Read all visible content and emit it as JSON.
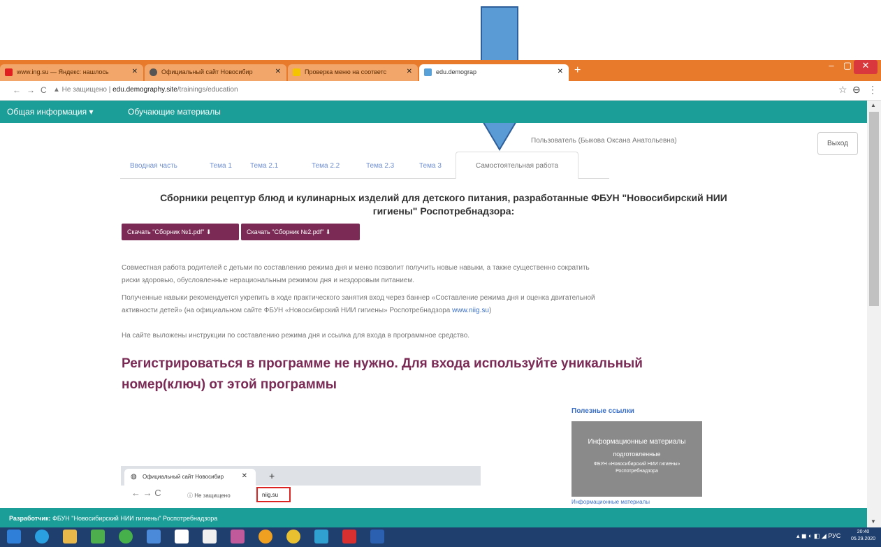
{
  "browser": {
    "tabs": [
      {
        "title": "www.ing.su — Яндекс: нашлось",
        "icon_color": "#e02020"
      },
      {
        "title": "Официальный сайт Новосибир",
        "icon_color": "#555555"
      },
      {
        "title": "Проверка меню на соответс",
        "icon_color": "#f5c400"
      },
      {
        "title": "edu.demograp",
        "icon_color": "#58a0d8",
        "active": true
      }
    ],
    "new_tab": "+",
    "window_controls": {
      "minimize": "–",
      "maximize": "▢",
      "close": "✕"
    },
    "nav": {
      "back": "←",
      "forward": "→",
      "reload": "C"
    },
    "url_secure_label": "▲ Не защищено",
    "url_host": "edu.demography.site",
    "url_path": "/trainings/education",
    "star": "☆",
    "account": "⊖",
    "menu": "⋮"
  },
  "site_nav": {
    "items": [
      "Общая информация ▾",
      "Обучающие материалы"
    ]
  },
  "user": {
    "label": "Пользователь (Быкова Оксана Анатольевна)",
    "logout": "Выход"
  },
  "page_tabs": [
    "Вводная часть",
    "Тема 1",
    "Тема 2.1",
    "Тема 2.2",
    "Тема 2.3",
    "Тема 3",
    "Самостоятельная работа"
  ],
  "active_tab_index": 6,
  "content": {
    "heading_line1": "Сборники рецептур блюд и кулинарных изделий для детского питания, разработанные ФБУН \"Новосибирский НИИ",
    "heading_line2": "гигиены\" Роспотребнадзора:",
    "download_buttons": [
      "Скачать \"Сборник №1.pdf\" ⬇",
      "Скачать \"Сборник №2.pdf\" ⬇"
    ],
    "para1_line1": "Совместная работа родителей с детьми по составлению режима дня и меню позволит получить новые навыки, а также существенно сократить",
    "para1_line2": "риски здоровью, обусловленные нерациональным режимом дня и нездоровым питанием.",
    "para2_line1": "Полученные навыки рекомендуется укрепить в ходе практического занятия вход через баннер «Составление режима дня и оценка двигательной",
    "para2_line2": "активности детей» (на официальном сайте ФБУН «Новосибирский НИИ гигиены» Роспотребнадзора ",
    "para2_link": "www.niig.su",
    "para2_end": ")",
    "para3": "На сайте выложены инструкции по составлению режима дня и ссылка для входа в программное средство.",
    "big_title_line1": "Регистрироваться в программе не нужно. Для входа используйте уникальный",
    "big_title_line2": "номер(ключ) от этой программы"
  },
  "useful_links": {
    "title": "Полезные ссылки",
    "banner_line1": "Информационные материалы",
    "banner_line2": "подготовленные",
    "banner_line3": "ФБУН «Новосибирский НИИ гигиены»",
    "banner_line4": "Роспотребнадзора",
    "caption": "Информационные материалы"
  },
  "embedded_screenshot": {
    "tab_title": "Официальный сайт Новосибир",
    "tab_close": "✕",
    "new_tab": "+",
    "nav": "← → C",
    "url_secure_label": "ⓘ Не защищено",
    "url_highlight": "niig.su"
  },
  "footer": {
    "label": "Разработчик:",
    "text": " ФБУН \"Новосибирский НИИ гигиены\" Роспотребнадзора"
  },
  "taskbar": {
    "tray": "▴ ◼ ◐ ◧ ◢ РУС",
    "time": "20:40",
    "date": "05.29.2020"
  },
  "colors": {
    "teal": "#1a9e97",
    "plum": "#7a2a55",
    "browser_orange": "#e87a2c",
    "arrow_blue": "#5b9bd5",
    "link": "#3a6fc8"
  }
}
